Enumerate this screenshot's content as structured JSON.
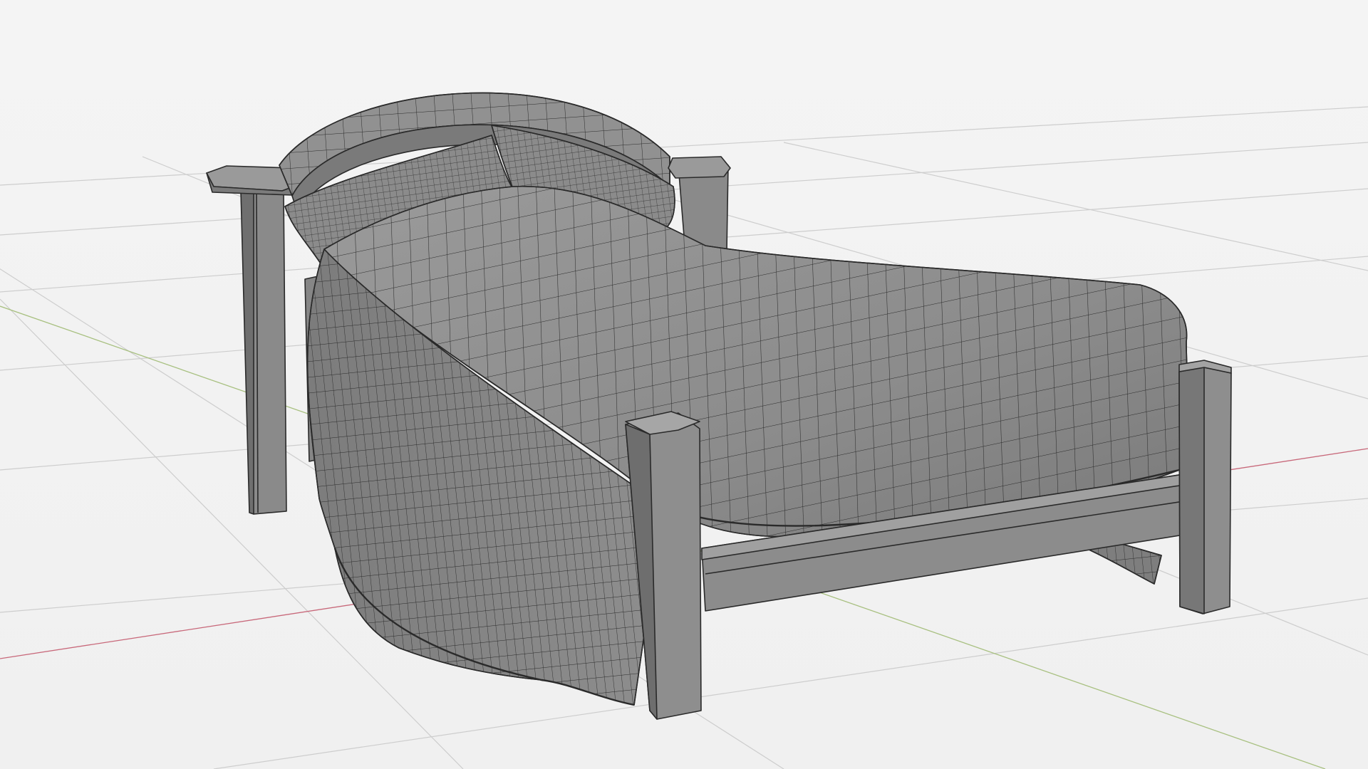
{
  "viewport": {
    "mode": "wireframe-on-shaded",
    "background_color": "#f2f2f2",
    "grid_color": "#cdcdcd",
    "axis_x_color": "#c8687a",
    "axis_y_color": "#a8c080",
    "mesh_fill_color": "#8e8e8e",
    "mesh_shadow_color": "#6f6f6f",
    "wire_color": "#2a2a2a"
  },
  "scene": {
    "object_icon": "bed-mesh-icon",
    "parts": [
      "headboard",
      "left-head-post",
      "right-head-post",
      "pillow-left",
      "pillow-right",
      "duvet",
      "footboard",
      "left-foot-post",
      "right-foot-post",
      "side-rail"
    ]
  }
}
